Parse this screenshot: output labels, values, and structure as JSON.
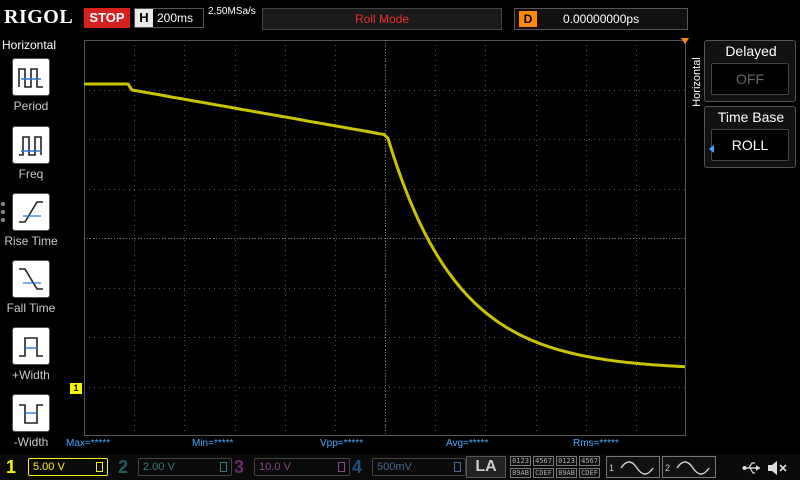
{
  "header": {
    "brand": "RIGOL",
    "run_state": "STOP",
    "h_key": "H",
    "timebase": "200ms",
    "sample_rate": "2.50MSa/s",
    "mode": "Roll Mode",
    "d_key": "D",
    "delay": "0.00000000ps"
  },
  "left_menu": {
    "title": "Horizontal",
    "items": [
      {
        "label": "Period",
        "icon": "period-icon"
      },
      {
        "label": "Freq",
        "icon": "frequency-icon"
      },
      {
        "label": "Rise Time",
        "icon": "rise-time-icon"
      },
      {
        "label": "Fall Time",
        "icon": "fall-time-icon"
      },
      {
        "label": "+Width",
        "icon": "positive-width-icon"
      },
      {
        "label": "-Width",
        "icon": "negative-width-icon"
      }
    ]
  },
  "right_panel": {
    "tab": "Horizontal",
    "delayed_title": "Delayed",
    "delayed_value": "OFF",
    "timebase_title": "Time Base",
    "timebase_value": "ROLL"
  },
  "measurements": {
    "max": "Max=*****",
    "min": "Min=*****",
    "vpp": "Vpp=*****",
    "avg": "Avg=*****",
    "rms": "Rms=*****"
  },
  "channels": [
    {
      "num": "1",
      "scale": "5.00 V",
      "color": "#f4f400"
    },
    {
      "num": "2",
      "scale": "2.00 V",
      "color": "#1f5f5f"
    },
    {
      "num": "3",
      "scale": "10.0 V",
      "color": "#6a2a6a"
    },
    {
      "num": "4",
      "scale": "500mV",
      "color": "#1f4f7f"
    }
  ],
  "la": {
    "label": "LA",
    "row1": [
      "0123",
      "4567",
      "0123",
      "4567"
    ],
    "row2": [
      "89AB",
      "CDEF",
      "89AB",
      "CDEF"
    ]
  },
  "generators": [
    "1",
    "2"
  ],
  "ch1_marker": "1",
  "colors": {
    "trace": "#c8c400",
    "grid": "#555555",
    "stop": "#d62020",
    "measurement": "#4aa8ff",
    "delay_key": "#ff8a00"
  }
}
